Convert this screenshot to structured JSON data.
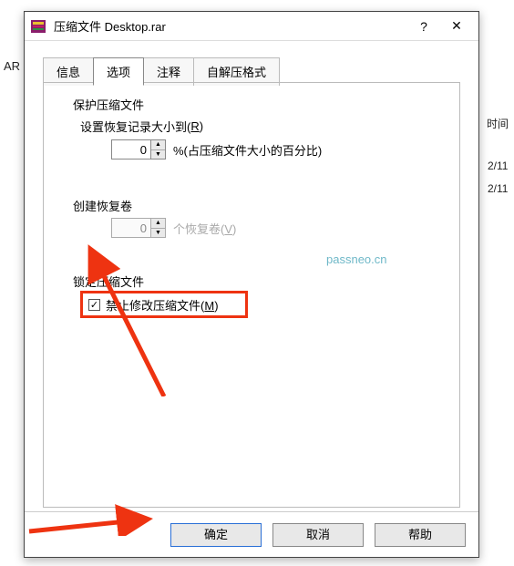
{
  "dialog": {
    "title": "压缩文件 Desktop.rar"
  },
  "tabs": {
    "info": "信息",
    "options": "选项",
    "comment": "注释",
    "sfx": "自解压格式"
  },
  "group": {
    "protect": "保护压缩文件",
    "recovery_size_label_pre": "设置恢复记录大小到(",
    "recovery_size_mn": "R",
    "recovery_value": "0",
    "recovery_suffix": "%(占压缩文件大小的百分比)",
    "volumes": "创建恢复卷",
    "volumes_value": "0",
    "volumes_suffix_pre": "个恢复卷(",
    "volumes_mn": "V",
    "lock": "锁定压缩文件",
    "lock_check_pre": "禁止修改压缩文件(",
    "lock_check_mn": "M"
  },
  "watermark": "passneo.cn",
  "buttons": {
    "ok": "确定",
    "cancel": "取消",
    "help": "帮助"
  },
  "background": {
    "ar_fragment": "AR 压",
    "time_col": "时间",
    "date_a": "2/11",
    "date_b": "2/11"
  }
}
